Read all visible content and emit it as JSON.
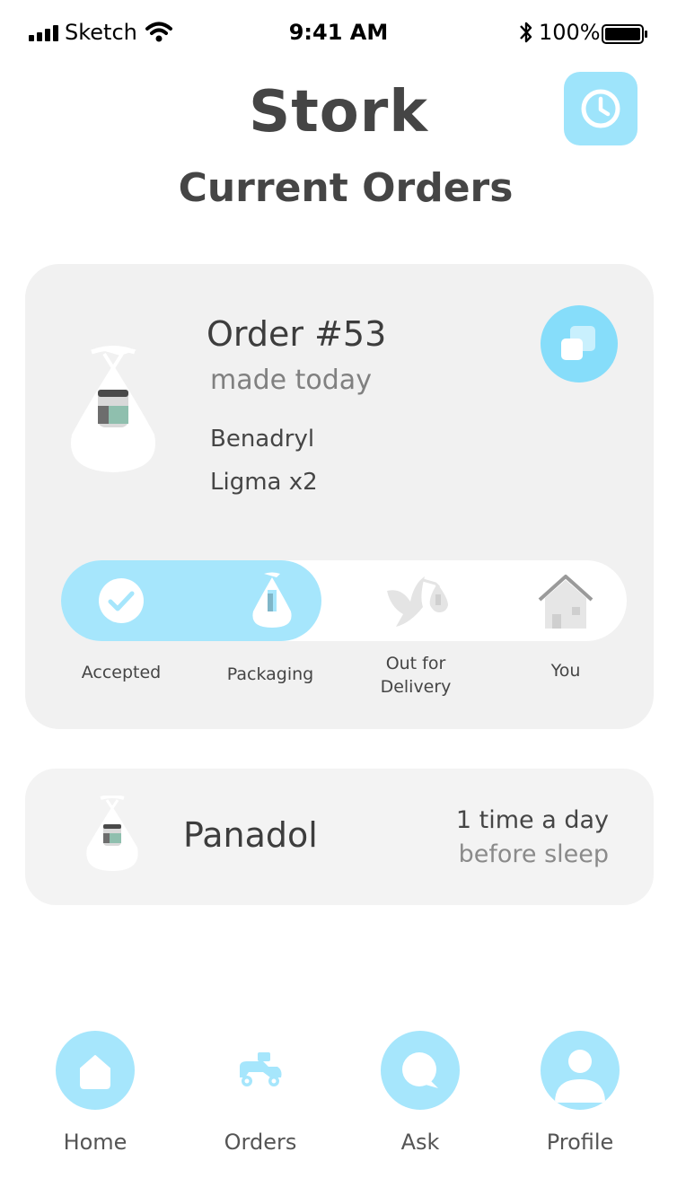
{
  "status_bar": {
    "carrier": "Sketch",
    "time": "9:41 AM",
    "battery": "100%"
  },
  "header": {
    "app_title": "Stork",
    "page_title": "Current Orders",
    "history_icon": "clock-icon"
  },
  "order": {
    "title": "Order #53",
    "subtitle": "made today",
    "items": [
      "Benadryl",
      "Ligma x2"
    ],
    "copy_icon": "copy-icon",
    "progress_fraction": 0.46,
    "steps": [
      {
        "label": "Accepted",
        "icon": "check-icon",
        "state": "done"
      },
      {
        "label": "Packaging",
        "icon": "bag-icon",
        "state": "current"
      },
      {
        "label": "Out for\nDelivery",
        "icon": "stork-icon",
        "state": "pending"
      },
      {
        "label": "You",
        "icon": "house-icon",
        "state": "pending"
      }
    ]
  },
  "prescription": {
    "name": "Panadol",
    "frequency": "1 time a day",
    "timing": "before sleep"
  },
  "nav": {
    "items": [
      {
        "label": "Home",
        "icon": "home-icon"
      },
      {
        "label": "Orders",
        "icon": "scooter-icon"
      },
      {
        "label": "Ask",
        "icon": "chat-icon"
      },
      {
        "label": "Profile",
        "icon": "user-icon"
      }
    ]
  },
  "colors": {
    "accent": "#a6e6fc",
    "accent_strong": "#86ddfa",
    "card_bg": "#f1f1f1",
    "text_dark": "#3d3d3d",
    "text_muted": "#808080"
  }
}
